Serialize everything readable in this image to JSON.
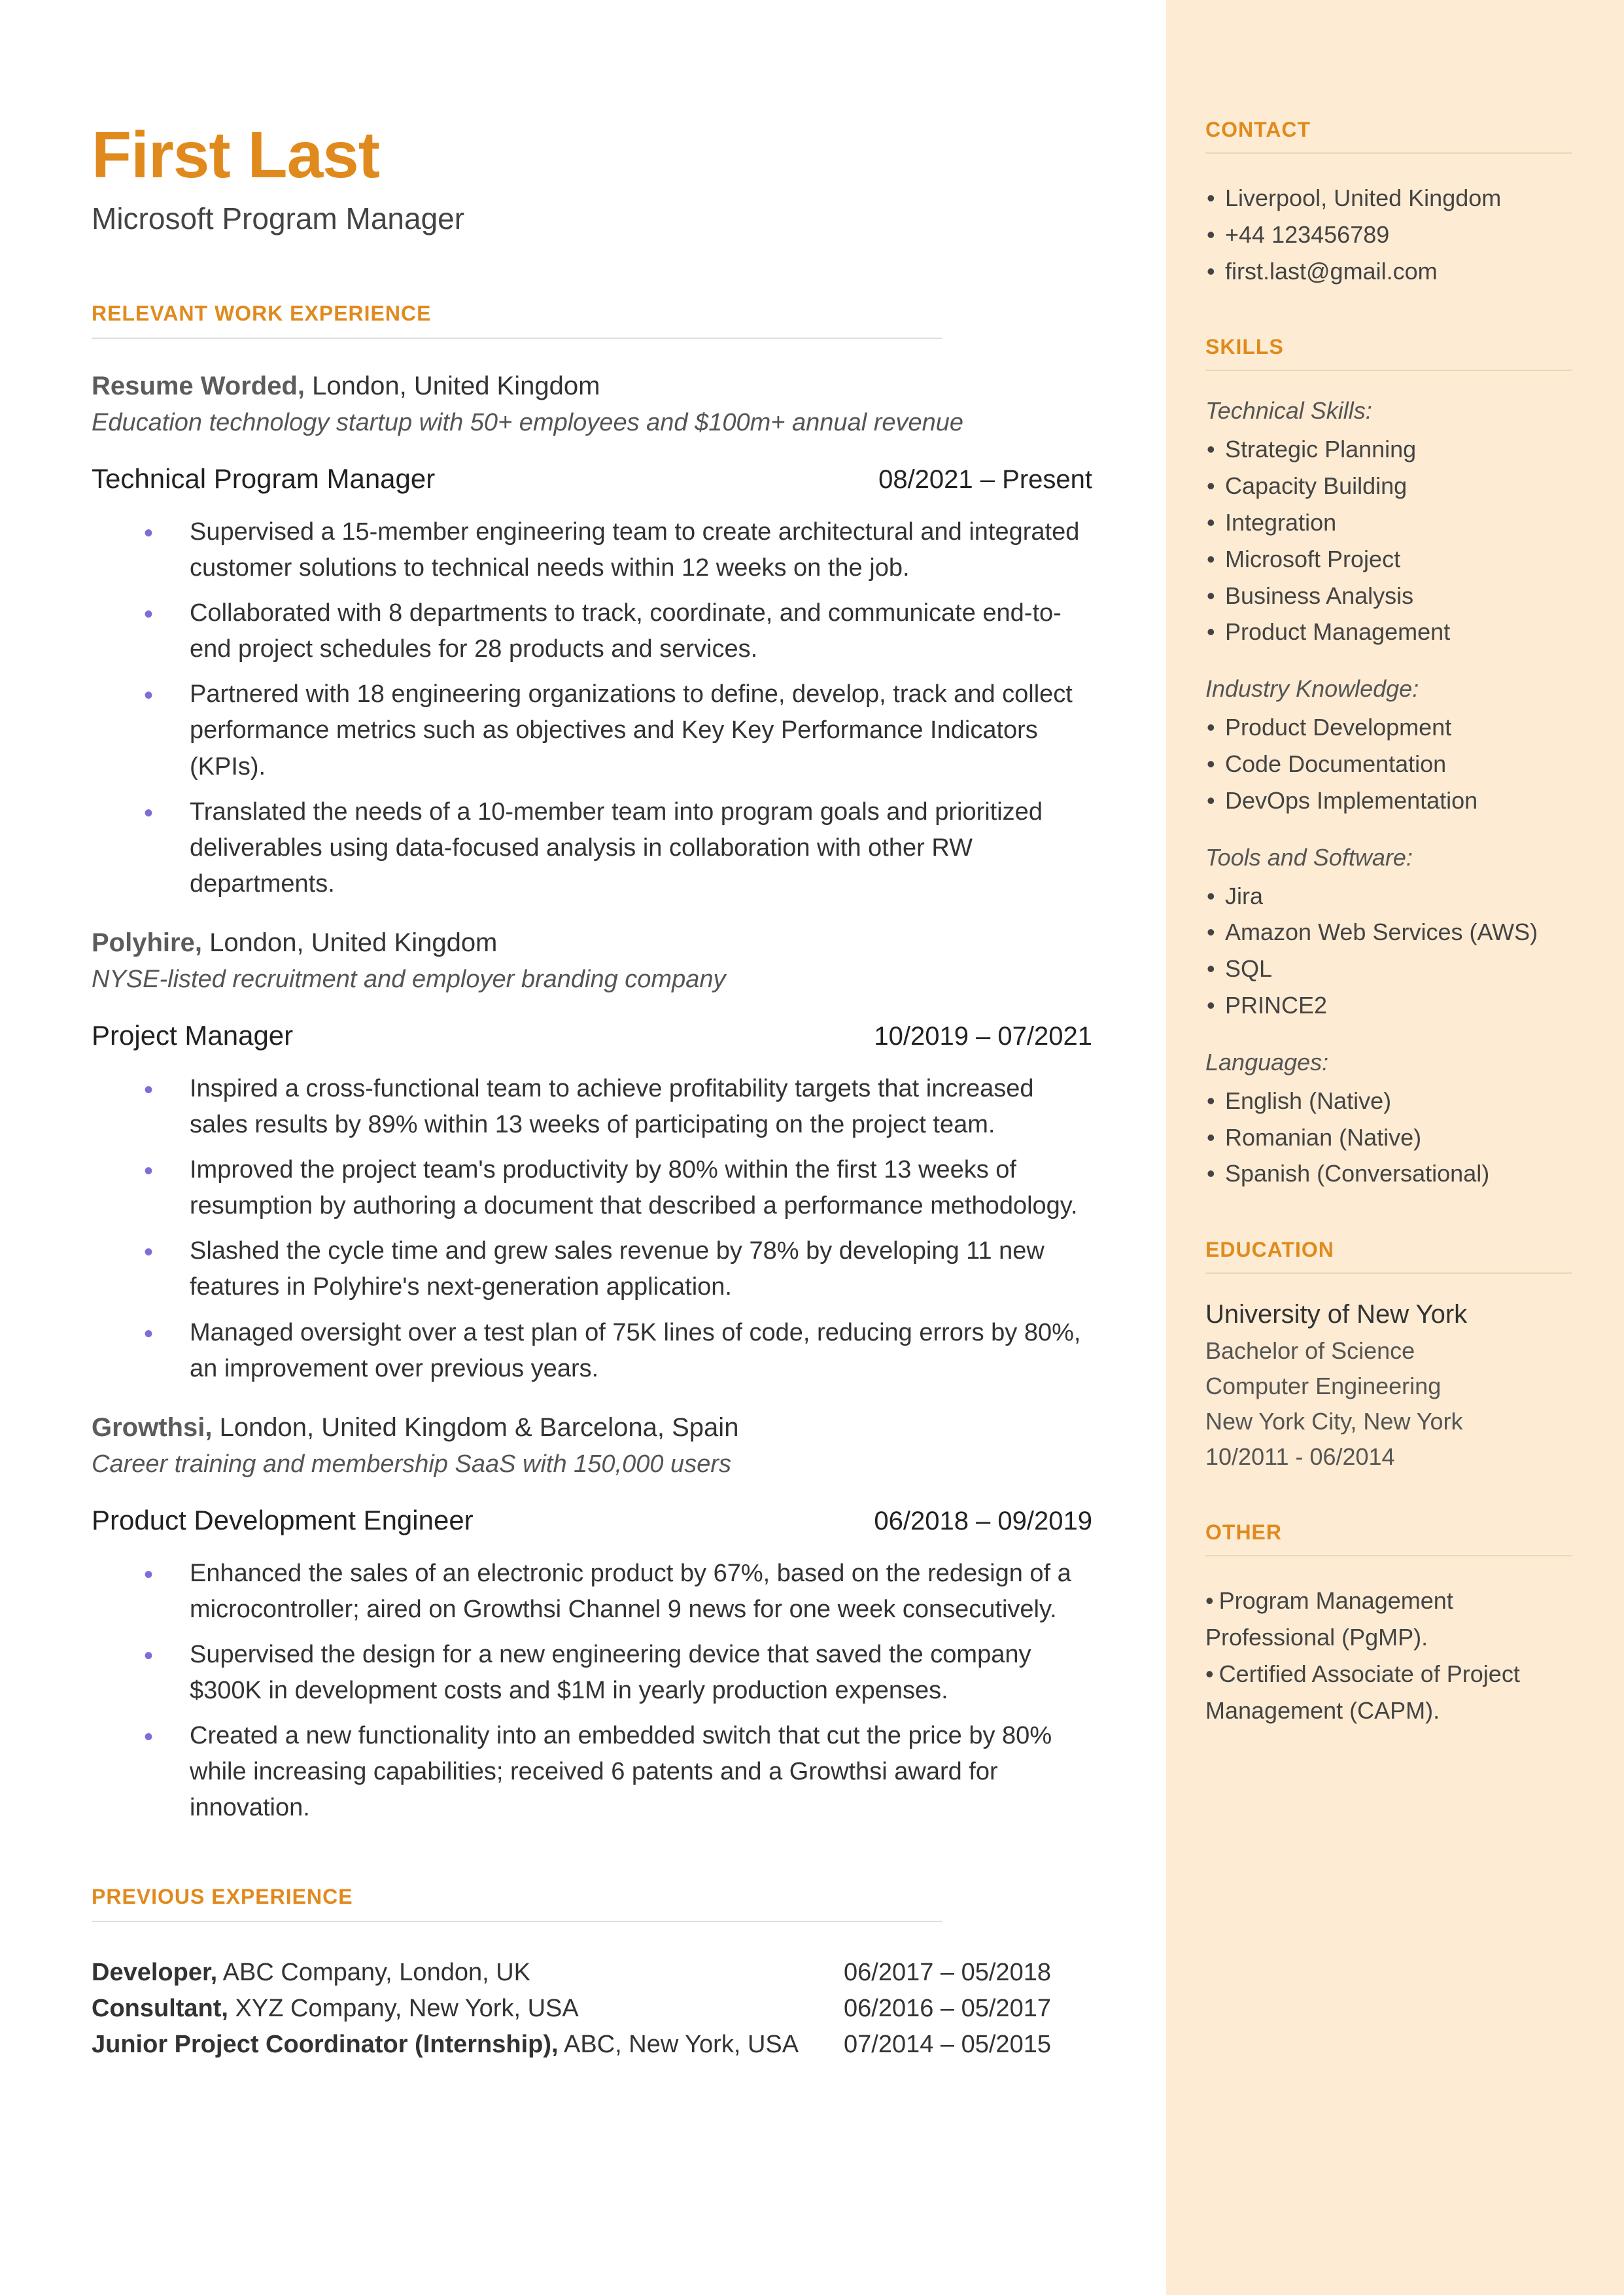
{
  "header": {
    "name": "First Last",
    "title": "Microsoft Program Manager"
  },
  "sections": {
    "work_heading": "RELEVANT WORK EXPERIENCE",
    "prev_heading": "PREVIOUS EXPERIENCE"
  },
  "jobs": [
    {
      "employer": "Resume Worded,",
      "location": " London, United Kingdom",
      "desc": "Education technology startup with 50+ employees and $100m+ annual revenue",
      "role": "Technical Program Manager",
      "dates": "08/2021 – Present",
      "bullets": [
        "Supervised a 15-member engineering team to create architectural and integrated customer solutions to technical needs within 12 weeks on the job.",
        "Collaborated with 8 departments to track, coordinate, and communicate end-to-end project schedules for 28 products and services.",
        "Partnered with 18 engineering organizations to define, develop, track and collect performance metrics such as objectives and Key Key Performance Indicators (KPIs).",
        "Translated the needs of a 10-member team into program goals and prioritized deliverables using data-focused analysis in collaboration with other RW departments."
      ]
    },
    {
      "employer": "Polyhire,",
      "location": " London, United Kingdom",
      "desc": "NYSE-listed recruitment and employer branding company",
      "role": "Project Manager",
      "dates": "10/2019 – 07/2021",
      "bullets": [
        "Inspired a cross-functional team to achieve profitability targets that increased sales results by 89% within 13 weeks of participating on the project team.",
        "Improved the project team's productivity by 80% within the first 13 weeks of resumption by authoring a document that described a  performance methodology.",
        "Slashed the cycle time and grew sales revenue by 78% by developing 11 new features in Polyhire's next-generation application.",
        "Managed oversight over a test plan of 75K lines of code, reducing errors by 80%, an improvement over previous years."
      ]
    },
    {
      "employer": "Growthsi,",
      "location": " London, United Kingdom & Barcelona, Spain",
      "desc": "Career training and membership SaaS with 150,000 users",
      "role": "Product Development Engineer",
      "dates": "06/2018 – 09/2019",
      "bullets": [
        "Enhanced the sales of an electronic product by 67%, based on the redesign of a microcontroller; aired on Growthsi Channel 9 news for one week consecutively.",
        "Supervised the design for a new engineering device that saved the company $300K in development costs and $1M in yearly production expenses.",
        "Created a new functionality into an embedded switch that cut the price by 80% while increasing capabilities; received 6 patents and a Growthsi award for innovation."
      ]
    }
  ],
  "previous": [
    {
      "title": "Developer,",
      "rest": " ABC Company, London, UK",
      "dates": "06/2017 – 05/2018"
    },
    {
      "title": "Consultant,",
      "rest": " XYZ Company, New York, USA",
      "dates": "06/2016 – 05/2017"
    },
    {
      "title": "Junior Project Coordinator (Internship),",
      "rest": " ABC, New York, USA",
      "dates": "07/2014 – 05/2015"
    }
  ],
  "sidebar": {
    "contact_heading": "CONTACT",
    "contact": [
      "Liverpool, United Kingdom",
      "+44 123456789",
      "first.last@gmail.com"
    ],
    "skills_heading": "SKILLS",
    "skills_groups": [
      {
        "title": "Technical Skills:",
        "items": [
          "Strategic Planning",
          "Capacity Building",
          "Integration",
          "Microsoft Project",
          "Business Analysis",
          "Product Management"
        ]
      },
      {
        "title": "Industry Knowledge:",
        "items": [
          "Product Development",
          "Code Documentation",
          "DevOps Implementation"
        ]
      },
      {
        "title": "Tools and Software:",
        "items": [
          "Jira",
          "Amazon Web Services (AWS)",
          "SQL",
          "PRINCE2"
        ]
      },
      {
        "title": "Languages:",
        "items": [
          "English (Native)",
          "Romanian (Native)",
          "Spanish (Conversational)"
        ]
      }
    ],
    "education_heading": "EDUCATION",
    "education": {
      "school": "University of New York",
      "degree": "Bachelor of Science",
      "field": "Computer Engineering",
      "location": "New York City, New York",
      "dates": "10/2011 - 06/2014"
    },
    "other_heading": "OTHER",
    "other": [
      "Program Management Professional (PgMP).",
      "Certified Associate of Project Management (CAPM)."
    ]
  }
}
